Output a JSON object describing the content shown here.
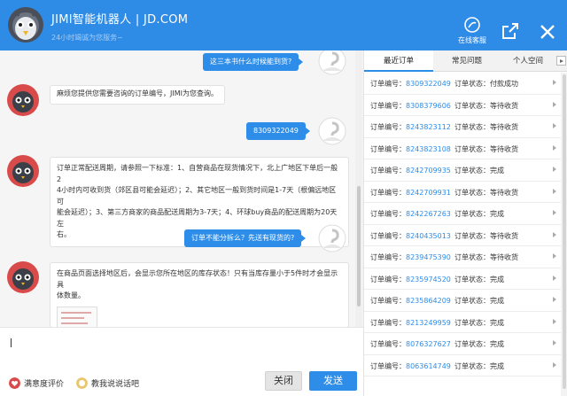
{
  "header": {
    "title": "JIMI智能机器人 | JD.COM",
    "subtitle": "24小时竭诚为您服务~",
    "online_service_label": "在线客服",
    "popout_icon": "popout-icon",
    "close_icon": "close-icon"
  },
  "chat": {
    "messages": [
      {
        "from": "user",
        "text": "这三本书什么时候能到货?"
      },
      {
        "from": "bot",
        "text": "麻烦您提供您需要咨询的订单编号，JIMI为您查询。"
      },
      {
        "from": "user",
        "text": "8309322049"
      },
      {
        "from": "bot",
        "line1": "订单正常配送周期，请参照一下标准：1、自营商品在现货情况下，北上广地区下单后一般2",
        "line2": "4小时内可收到货（郊区县可能会延迟）；2、其它地区一般到货时间是1-7天（根偏远地区可",
        "line3": "能会延迟）；3、第三方商家的商品配送周期为3-7天；4、环球buy商品的配送周期为20天左",
        "line4": "右。"
      },
      {
        "from": "user",
        "text": "订单不能分拆么？先送有现货的?"
      },
      {
        "from": "bot",
        "line1": "在商品页面选择地区后，会显示您所在地区的库存状态！只有当库存量小于5件时才会显示具",
        "line2": "体数量。"
      }
    ]
  },
  "footer": {
    "satisfaction_label": "满意度评价",
    "teach_label": "教我说说话吧",
    "close_button": "关闭",
    "send_button": "发送"
  },
  "panel": {
    "tabs": [
      "最近订单",
      "常见问题",
      "个人空间"
    ],
    "order_label": "订单编号：",
    "status_label": "订单状态：",
    "orders": [
      {
        "id": "8309322049",
        "status": "付款成功"
      },
      {
        "id": "8308379606",
        "status": "等待收货"
      },
      {
        "id": "8243823112",
        "status": "等待收货"
      },
      {
        "id": "8243823108",
        "status": "等待收货"
      },
      {
        "id": "8242709935",
        "status": "完成"
      },
      {
        "id": "8242709931",
        "status": "等待收货"
      },
      {
        "id": "8242267263",
        "status": "完成"
      },
      {
        "id": "8240435013",
        "status": "等待收货"
      },
      {
        "id": "8239475390",
        "status": "等待收货"
      },
      {
        "id": "8235974520",
        "status": "完成"
      },
      {
        "id": "8235864209",
        "status": "完成"
      },
      {
        "id": "8213249959",
        "status": "完成"
      },
      {
        "id": "8076327627",
        "status": "完成"
      },
      {
        "id": "8063614749",
        "status": "完成"
      }
    ]
  },
  "colors": {
    "header_bg": "#2e8be6",
    "user_bubble": "#2d8de8",
    "order_number": "#2d8de8",
    "bot_avatar": "#d94b4b"
  }
}
